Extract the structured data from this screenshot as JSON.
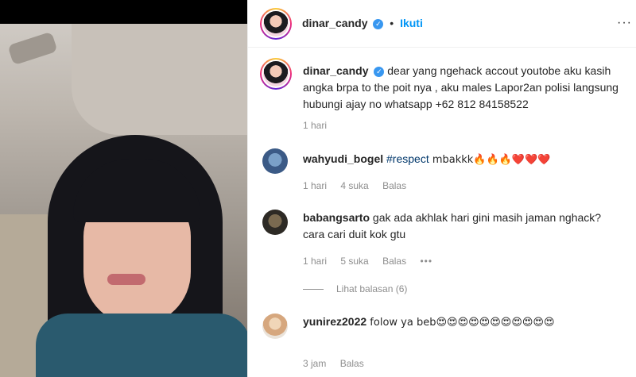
{
  "post": {
    "username": "dinar_candy",
    "follow_label": "Ikuti",
    "separator": "•",
    "more": "···"
  },
  "caption": {
    "username": "dinar_candy",
    "text": "dear yang ngehack accout youtobe aku kasih angka brpa to the poit nya , aku males Lapor2an polisi langsung hubungi ajay no whatsapp +62 812 84158522",
    "time": "1 hari"
  },
  "comments": [
    {
      "username": "wahyudi_bogel",
      "tag": "#respect",
      "text": " mbakkk🔥🔥🔥❤️❤️❤️",
      "time": "1 hari",
      "likes": "4 suka",
      "reply": "Balas"
    },
    {
      "username": "babangsarto",
      "text": " gak ada akhlak hari gini masih jaman nghack? cara cari duit kok gtu",
      "time": "1 hari",
      "likes": "5 suka",
      "reply": "Balas",
      "options": "•••"
    },
    {
      "username": "yunirez2022",
      "text": " folow ya beb😍😍😍😍😍😍😍😍😍😍😍",
      "time": "3 jam",
      "reply": "Balas"
    }
  ],
  "view_replies": "Lihat balasan (6)",
  "colors": {
    "link": "#0095f6",
    "hashtag": "#00376b",
    "muted": "#8e8e8e",
    "verified": "#3897f0"
  },
  "icons": {
    "verified": "verified-badge-icon",
    "more": "more-options-icon"
  }
}
